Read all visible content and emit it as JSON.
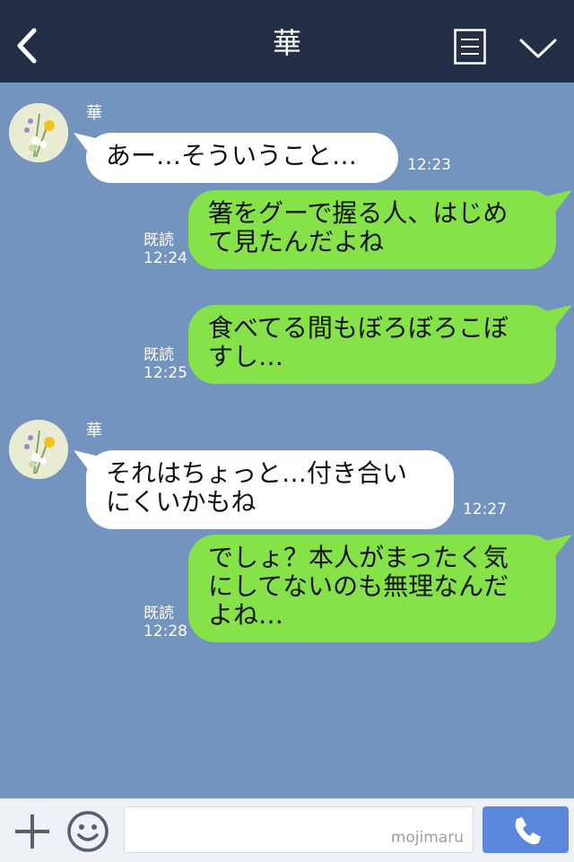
{
  "header": {
    "title": "華",
    "back_icon": "chevron-left-icon",
    "menu_icon": "menu-icon",
    "collapse_icon": "chevron-down-icon"
  },
  "messages": [
    {
      "direction": "incoming",
      "sender": "華",
      "lines": [
        "あー…そういうこと…"
      ],
      "time": "12:23"
    },
    {
      "direction": "outgoing",
      "lines": [
        "箸をグーで握る人、はじめ",
        "て見たんだよね"
      ],
      "read": "既読",
      "time": "12:24"
    },
    {
      "direction": "outgoing",
      "lines": [
        "食べてる間もぼろぼろこぼ",
        "すし…"
      ],
      "read": "既読",
      "time": "12:25"
    },
    {
      "direction": "incoming",
      "sender": "華",
      "lines": [
        "それはちょっと…付き合い",
        "にくいかもね"
      ],
      "time": "12:27"
    },
    {
      "direction": "outgoing",
      "lines": [
        "でしょ？本人がまったく気",
        "にしてないのも無理なんだ",
        "よね…"
      ],
      "read": "既読",
      "time": "12:28"
    }
  ],
  "footer": {
    "plus_icon": "plus-icon",
    "emoji_icon": "smiley-icon",
    "input_placeholder": "",
    "watermark": "mojimaru",
    "call_icon": "phone-icon"
  },
  "colors": {
    "header_bg": "#252e47",
    "chat_bg": "#7494c0",
    "outgoing_bubble": "#85e249",
    "incoming_bubble": "#ffffff",
    "call_button": "#5b87dc"
  }
}
